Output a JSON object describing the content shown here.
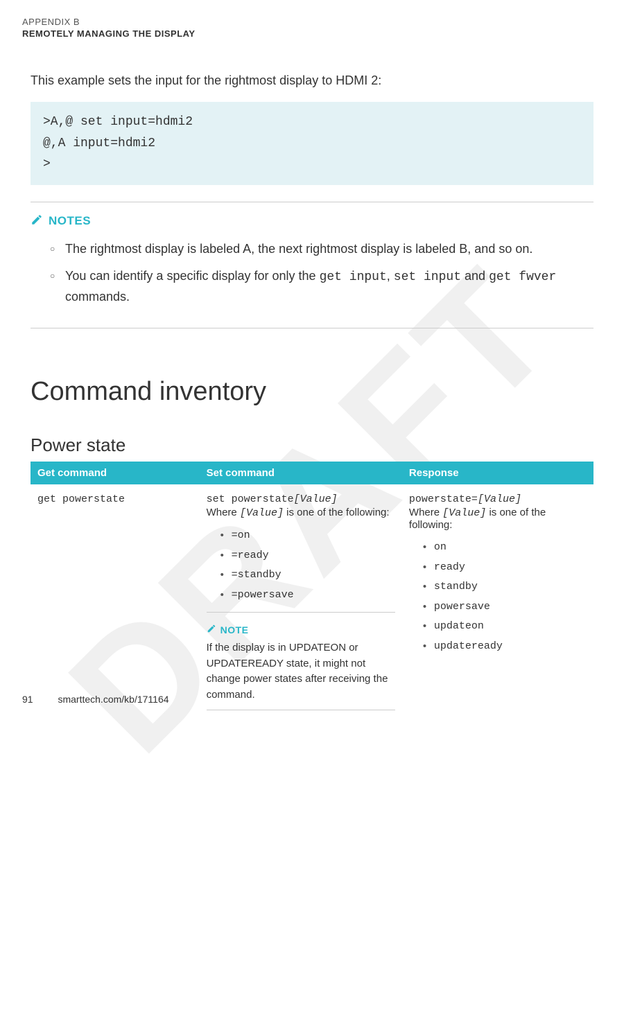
{
  "header": {
    "appendix_label": "APPENDIX B",
    "appendix_title": "REMOTELY MANAGING THE DISPLAY"
  },
  "watermark": "DRAFT",
  "intro": "This example sets the input for the rightmost display to HDMI 2:",
  "code_block": ">A,@ set input=hdmi2\n@,A input=hdmi2\n>",
  "notes": {
    "label": "NOTES",
    "items": [
      {
        "text": "The rightmost display is labeled A, the next rightmost display is labeled B, and so on."
      },
      {
        "prefix": "You can identify a specific display for only the ",
        "c1": "get input",
        "mid1": ", ",
        "c2": "set input",
        "mid2": " and ",
        "c3": "get fwver",
        "suffix": " commands."
      }
    ]
  },
  "section_heading": "Command inventory",
  "subsection_heading": "Power state",
  "table": {
    "headers": {
      "get": "Get command",
      "set": "Set command",
      "response": "Response"
    },
    "row": {
      "get_cmd": "get powerstate",
      "set_cmd_prefix": "set powerstate",
      "set_cmd_value": "[Value]",
      "set_where_prefix": "Where ",
      "set_where_val": "[Value]",
      "set_where_suffix": " is one of the following:",
      "set_options": [
        "=on",
        "=ready",
        "=standby",
        "=powersave"
      ],
      "set_note_label": "NOTE",
      "set_note_text": "If the display is in UPDATEON or UPDATEREADY state, it might not change power states after receiving the command.",
      "resp_prefix": "powerstate=",
      "resp_value": "[Value]",
      "resp_where_prefix": "Where ",
      "resp_where_val": "[Value]",
      "resp_where_suffix": " is one of the following:",
      "resp_options": [
        "on",
        "ready",
        "standby",
        "powersave",
        "updateon",
        "updateready"
      ]
    }
  },
  "footer": {
    "page": "91",
    "link": "smarttech.com/kb/171164"
  }
}
